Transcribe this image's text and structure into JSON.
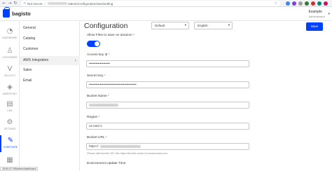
{
  "browser": {
    "security_label": "Not secure",
    "url_path": "/admin/configuration/aws/setting",
    "extensions": [
      {
        "name": "google-icon",
        "color": "#4285f4"
      },
      {
        "name": "extension-icon-purple",
        "color": "#7b3fe4"
      },
      {
        "name": "extension-icon-gray",
        "color": "#9e9e9e"
      },
      {
        "name": "extension-icon-green",
        "color": "#2e7d32"
      },
      {
        "name": "extension-icon-red",
        "color": "#d32f2f"
      },
      {
        "name": "extension-icon-teal",
        "color": "#00897b"
      },
      {
        "name": "profile-avatar-icon",
        "color": "#c2185b"
      }
    ]
  },
  "header": {
    "logo_text": "bagisto",
    "user_name": "Example",
    "user_role": "Administrator"
  },
  "icon_nav": [
    {
      "name": "dashboard",
      "label": "DASHBOARD",
      "icon": "gauge-icon",
      "glyph": "◔",
      "active": false
    },
    {
      "name": "customers",
      "label": "CUSTOMERS",
      "icon": "users-icon",
      "glyph": "♙",
      "active": false
    },
    {
      "name": "velocity",
      "label": "VELOCITY",
      "icon": "velocity-icon",
      "glyph": "V",
      "active": false
    },
    {
      "name": "marketing",
      "label": "MARKETING",
      "icon": "megaphone-icon",
      "glyph": "◈",
      "active": false
    },
    {
      "name": "cms",
      "label": "CMS",
      "icon": "page-icon",
      "glyph": "▤",
      "active": false
    },
    {
      "name": "settings",
      "label": "SETTINGS",
      "icon": "gear-icon",
      "glyph": "⚙",
      "active": false
    },
    {
      "name": "configure",
      "label": "CONFIGURE",
      "icon": "wrench-icon",
      "glyph": "✎",
      "active": true
    },
    {
      "name": "more",
      "label": "",
      "icon": "more-icon",
      "glyph": "▦",
      "active": false
    }
  ],
  "submenu": [
    {
      "label": "General",
      "active": false,
      "arrow": ""
    },
    {
      "label": "Catalog",
      "active": false,
      "arrow": ""
    },
    {
      "label": "Customer",
      "active": false,
      "arrow": ""
    },
    {
      "label": "AWS Integration",
      "active": true,
      "arrow": "›"
    },
    {
      "label": "Sales",
      "active": false,
      "arrow": ""
    },
    {
      "label": "Email",
      "active": false,
      "arrow": ""
    }
  ],
  "main": {
    "title": "Configuration",
    "channel_select": "Default",
    "locale_select": "English",
    "save_label": "Save",
    "allow_files_label": "Allow Files to save on amazon",
    "allow_files_enabled": true,
    "access_key_label": "Access key id",
    "access_key_value": "•••••••••••••••••••",
    "secret_key_label": "Secret Key",
    "secret_key_value": "•••••••••••••••••••••••••••••••••••••••••••",
    "bucket_name_label": "Bucket Name",
    "region_label": "Region",
    "region_value": "us-east-1",
    "bucket_url_label": "Bucket URL",
    "bucket_url_prefix": "https://",
    "bucket_url_help": "Please add bucket URL like https://bucket-name.s3.amazonaws.com",
    "env_update_label": "Environment Update Time",
    "required_mark": "*"
  },
  "status_bar": {
    "url": "18.84.47.195/admin/dashboard"
  }
}
